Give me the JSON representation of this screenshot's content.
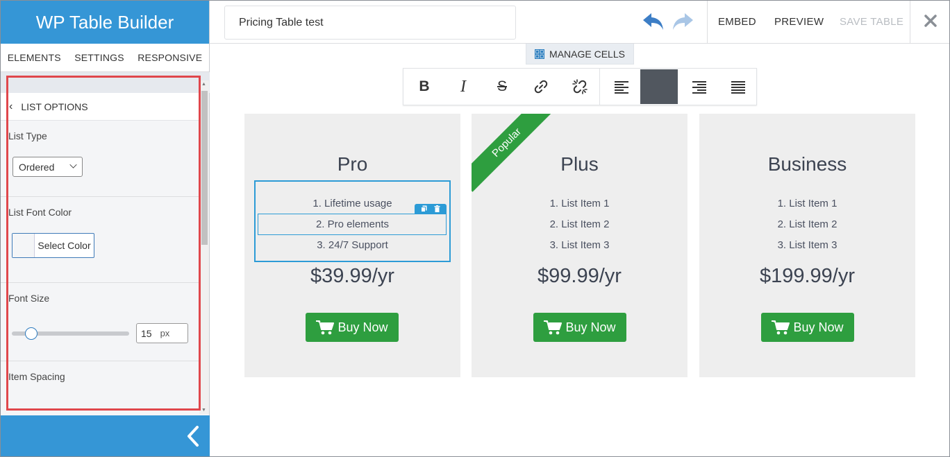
{
  "sidebar": {
    "brand": "WP Table Builder",
    "tabs": [
      "ELEMENTS",
      "SETTINGS",
      "RESPONSIVE"
    ],
    "panel_title": "LIST OPTIONS",
    "list_type": {
      "label": "List Type",
      "value": "Ordered"
    },
    "list_font_color": {
      "label": "List Font Color",
      "button": "Select Color"
    },
    "font_size": {
      "label": "Font Size",
      "value": "15",
      "unit": "px",
      "slider_fraction": 0.15
    },
    "item_spacing": {
      "label": "Item Spacing"
    }
  },
  "topbar": {
    "table_title": "Pricing Table test",
    "embed": "EMBED",
    "preview": "PREVIEW",
    "save": "SAVE TABLE"
  },
  "toolbar": {
    "manage_cells": "MANAGE CELLS",
    "buttons": [
      "bold-icon",
      "italic-icon",
      "strikethrough-icon",
      "link-icon",
      "unlink-icon",
      "align-left-icon",
      "align-center-icon",
      "align-right-icon",
      "align-justify-icon"
    ],
    "active_button": "align-center-icon",
    "active_color": "#51575f"
  },
  "cards": [
    {
      "name": "Pro",
      "items": [
        "1. Lifetime usage",
        "2. Pro elements",
        "3. 24/7 Support"
      ],
      "price": "$39.99/yr",
      "button": "Buy Now"
    },
    {
      "name": "Plus",
      "ribbon": "Popular",
      "items": [
        "1. List Item 1",
        "2. List Item 2",
        "3. List Item 3"
      ],
      "price": "$99.99/yr",
      "button": "Buy Now"
    },
    {
      "name": "Business",
      "items": [
        "1. List Item 1",
        "2. List Item 2",
        "3. List Item 3"
      ],
      "price": "$199.99/yr",
      "button": "Buy Now"
    }
  ],
  "colors": {
    "brand_blue": "#3596d6",
    "buy_green": "#2e9e3f",
    "card_bg": "#eeeeee",
    "highlight_red": "#e0474c",
    "selection_blue": "#2c9bd6"
  }
}
